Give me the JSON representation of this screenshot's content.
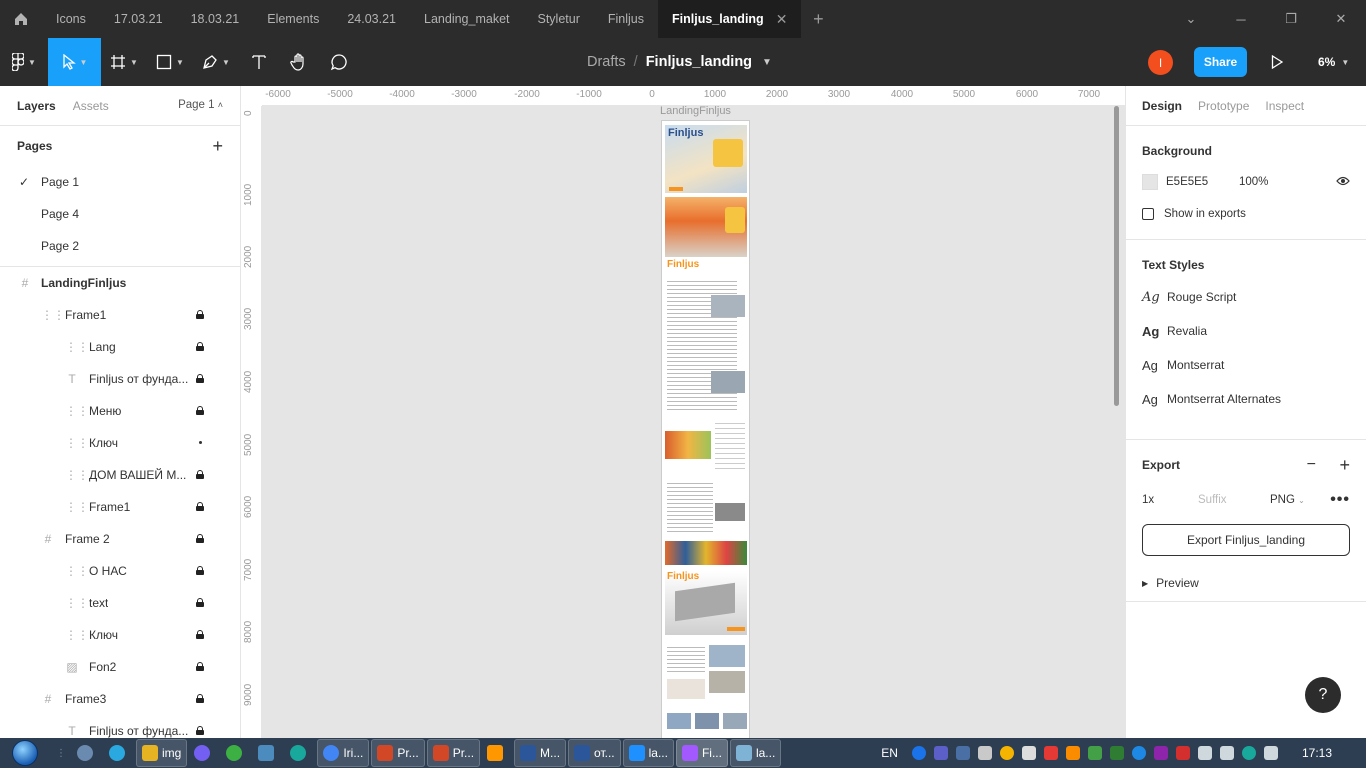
{
  "tabs": {
    "items": [
      {
        "label": "Icons"
      },
      {
        "label": "17.03.21"
      },
      {
        "label": "18.03.21"
      },
      {
        "label": "Elements"
      },
      {
        "label": "24.03.21"
      },
      {
        "label": "Landing_maket"
      },
      {
        "label": "Styletur"
      },
      {
        "label": "Finljus"
      },
      {
        "label": "Finljus_landing",
        "active": true
      }
    ]
  },
  "toolbar": {
    "breadcrumb_root": "Drafts",
    "breadcrumb_sep": "/",
    "file_name": "Finljus_landing",
    "avatar_letter": "I",
    "share_label": "Share",
    "zoom": "6%"
  },
  "left_panel": {
    "tab_layers": "Layers",
    "tab_assets": "Assets",
    "page_selector": "Page 1",
    "pages_title": "Pages",
    "pages": [
      "Page 1",
      "Page 4",
      "Page 2"
    ],
    "layers": [
      {
        "name": "LandingFinljus",
        "icon": "frame-icon",
        "level": 0
      },
      {
        "name": "Frame1",
        "icon": "group-icon",
        "level": 1,
        "state": "locked"
      },
      {
        "name": "Lang",
        "icon": "group-icon",
        "level": 2,
        "state": "locked"
      },
      {
        "name": "Finljus от фунда...",
        "icon": "text-icon",
        "level": 2,
        "state": "locked"
      },
      {
        "name": "Меню",
        "icon": "group-icon",
        "level": 2,
        "state": "locked"
      },
      {
        "name": "Ключ",
        "icon": "group-icon",
        "level": 2,
        "state": "dot"
      },
      {
        "name": "ДОМ ВАШЕЙ М...",
        "icon": "group-icon",
        "level": 2,
        "state": "locked"
      },
      {
        "name": "Frame1",
        "icon": "group-icon",
        "level": 2,
        "state": "locked"
      },
      {
        "name": "Frame 2",
        "icon": "frame-icon",
        "level": 1,
        "state": "locked"
      },
      {
        "name": "О НАС",
        "icon": "group-icon",
        "level": 2,
        "state": "locked"
      },
      {
        "name": "text",
        "icon": "group-icon",
        "level": 2,
        "state": "locked"
      },
      {
        "name": "Ключ",
        "icon": "group-icon",
        "level": 2,
        "state": "locked"
      },
      {
        "name": "Fon2",
        "icon": "image-icon",
        "level": 2,
        "state": "locked"
      },
      {
        "name": "Frame3",
        "icon": "frame-icon",
        "level": 1,
        "state": "locked"
      },
      {
        "name": "Finljus от фунда...",
        "icon": "text-icon",
        "level": 2,
        "state": "locked"
      }
    ]
  },
  "canvas": {
    "frame_label": "LandingFinljus",
    "ruler_top": [
      "-6000",
      "-5000",
      "-4000",
      "-3000",
      "-2000",
      "-1000",
      "0",
      "1000",
      "2000",
      "3000",
      "4000",
      "5000",
      "6000",
      "7000"
    ],
    "ruler_left": [
      "0",
      "1000",
      "2000",
      "3000",
      "4000",
      "5000",
      "6000",
      "7000",
      "8000",
      "9000",
      "00"
    ],
    "frame_texts": {
      "logo1": "Finljus",
      "logo2": "Finljus",
      "logo3": "Finljus"
    }
  },
  "right_panel": {
    "tab_design": "Design",
    "tab_prototype": "Prototype",
    "tab_inspect": "Inspect",
    "background_title": "Background",
    "bg_hex": "E5E5E5",
    "bg_opacity": "100%",
    "show_in_exports": "Show in exports",
    "text_styles_title": "Text Styles",
    "text_styles": [
      {
        "icon": "Ag",
        "name": "Rouge Script"
      },
      {
        "icon": "Ag",
        "name": "Revalia"
      },
      {
        "icon": "Ag",
        "name": "Montserrat"
      },
      {
        "icon": "Ag",
        "name": "Montserrat Alternates"
      }
    ],
    "export_title": "Export",
    "export_scale": "1x",
    "export_suffix_placeholder": "Suffix",
    "export_format": "PNG",
    "export_button": "Export Finljus_landing",
    "preview_label": "Preview"
  },
  "help_label": "?",
  "taskbar": {
    "items": [
      {
        "label": "img",
        "color": "#e6b422"
      },
      {
        "label": "Iri...",
        "color": "#4285f4"
      },
      {
        "label": "Pr...",
        "color": "#d24726"
      },
      {
        "label": "Pr...",
        "color": "#d24726"
      },
      {
        "label": "M...",
        "color": "#2b579a"
      },
      {
        "label": "от...",
        "color": "#2b579a"
      },
      {
        "label": "la...",
        "color": "#1e90ff"
      },
      {
        "label": "Fi...",
        "color": "#a259ff"
      },
      {
        "label": "la...",
        "color": "#7fb3d5"
      }
    ],
    "lang": "EN",
    "time": "17:13"
  },
  "colors": {
    "accent": "#18a0fb",
    "avatar": "#f24e1e",
    "chrome_dark": "#2c2c2c",
    "canvas_bg": "#e5e5e5",
    "brand_orange": "#f7941d"
  }
}
